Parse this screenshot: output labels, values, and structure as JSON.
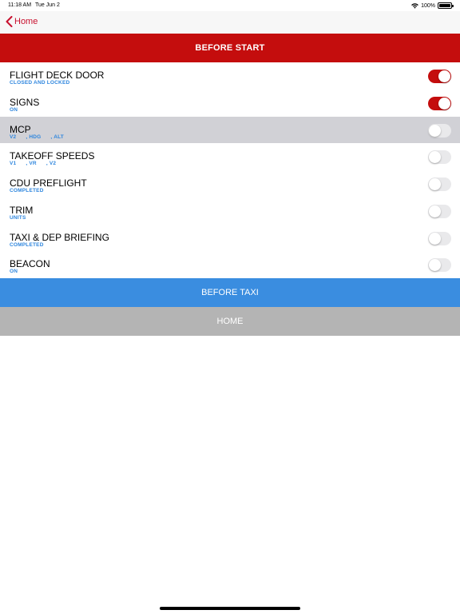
{
  "status": {
    "time": "11:18 AM",
    "date": "Tue Jun 2",
    "battery": "100%"
  },
  "nav": {
    "back_label": "Home"
  },
  "section": {
    "title": "BEFORE START"
  },
  "colors": {
    "accent": "#c40d0d",
    "link": "#2e86de",
    "primary_button": "#3a8de0",
    "secondary_button": "#b4b4b4"
  },
  "items": [
    {
      "title": "FLIGHT DECK DOOR",
      "subs": [
        "CLOSED AND LOCKED"
      ],
      "on": true
    },
    {
      "title": "SIGNS",
      "subs": [
        "ON"
      ],
      "on": true
    },
    {
      "title": "MCP",
      "subs": [
        "V2",
        ", HDG",
        ", ALT"
      ],
      "on": false,
      "highlighted": true
    },
    {
      "title": "TAKEOFF SPEEDS",
      "subs": [
        "V1",
        ", VR",
        ", V2"
      ],
      "on": false
    },
    {
      "title": "CDU PREFLIGHT",
      "subs": [
        "COMPLETED"
      ],
      "on": false
    },
    {
      "title": "TRIM",
      "subs": [
        "UNITS"
      ],
      "on": false
    },
    {
      "title": "TAXI & DEP BRIEFING",
      "subs": [
        "COMPLETED"
      ],
      "on": false
    },
    {
      "title": "BEACON",
      "subs": [
        "ON"
      ],
      "on": false
    }
  ],
  "buttons": {
    "next": "BEFORE TAXI",
    "home": "HOME"
  }
}
